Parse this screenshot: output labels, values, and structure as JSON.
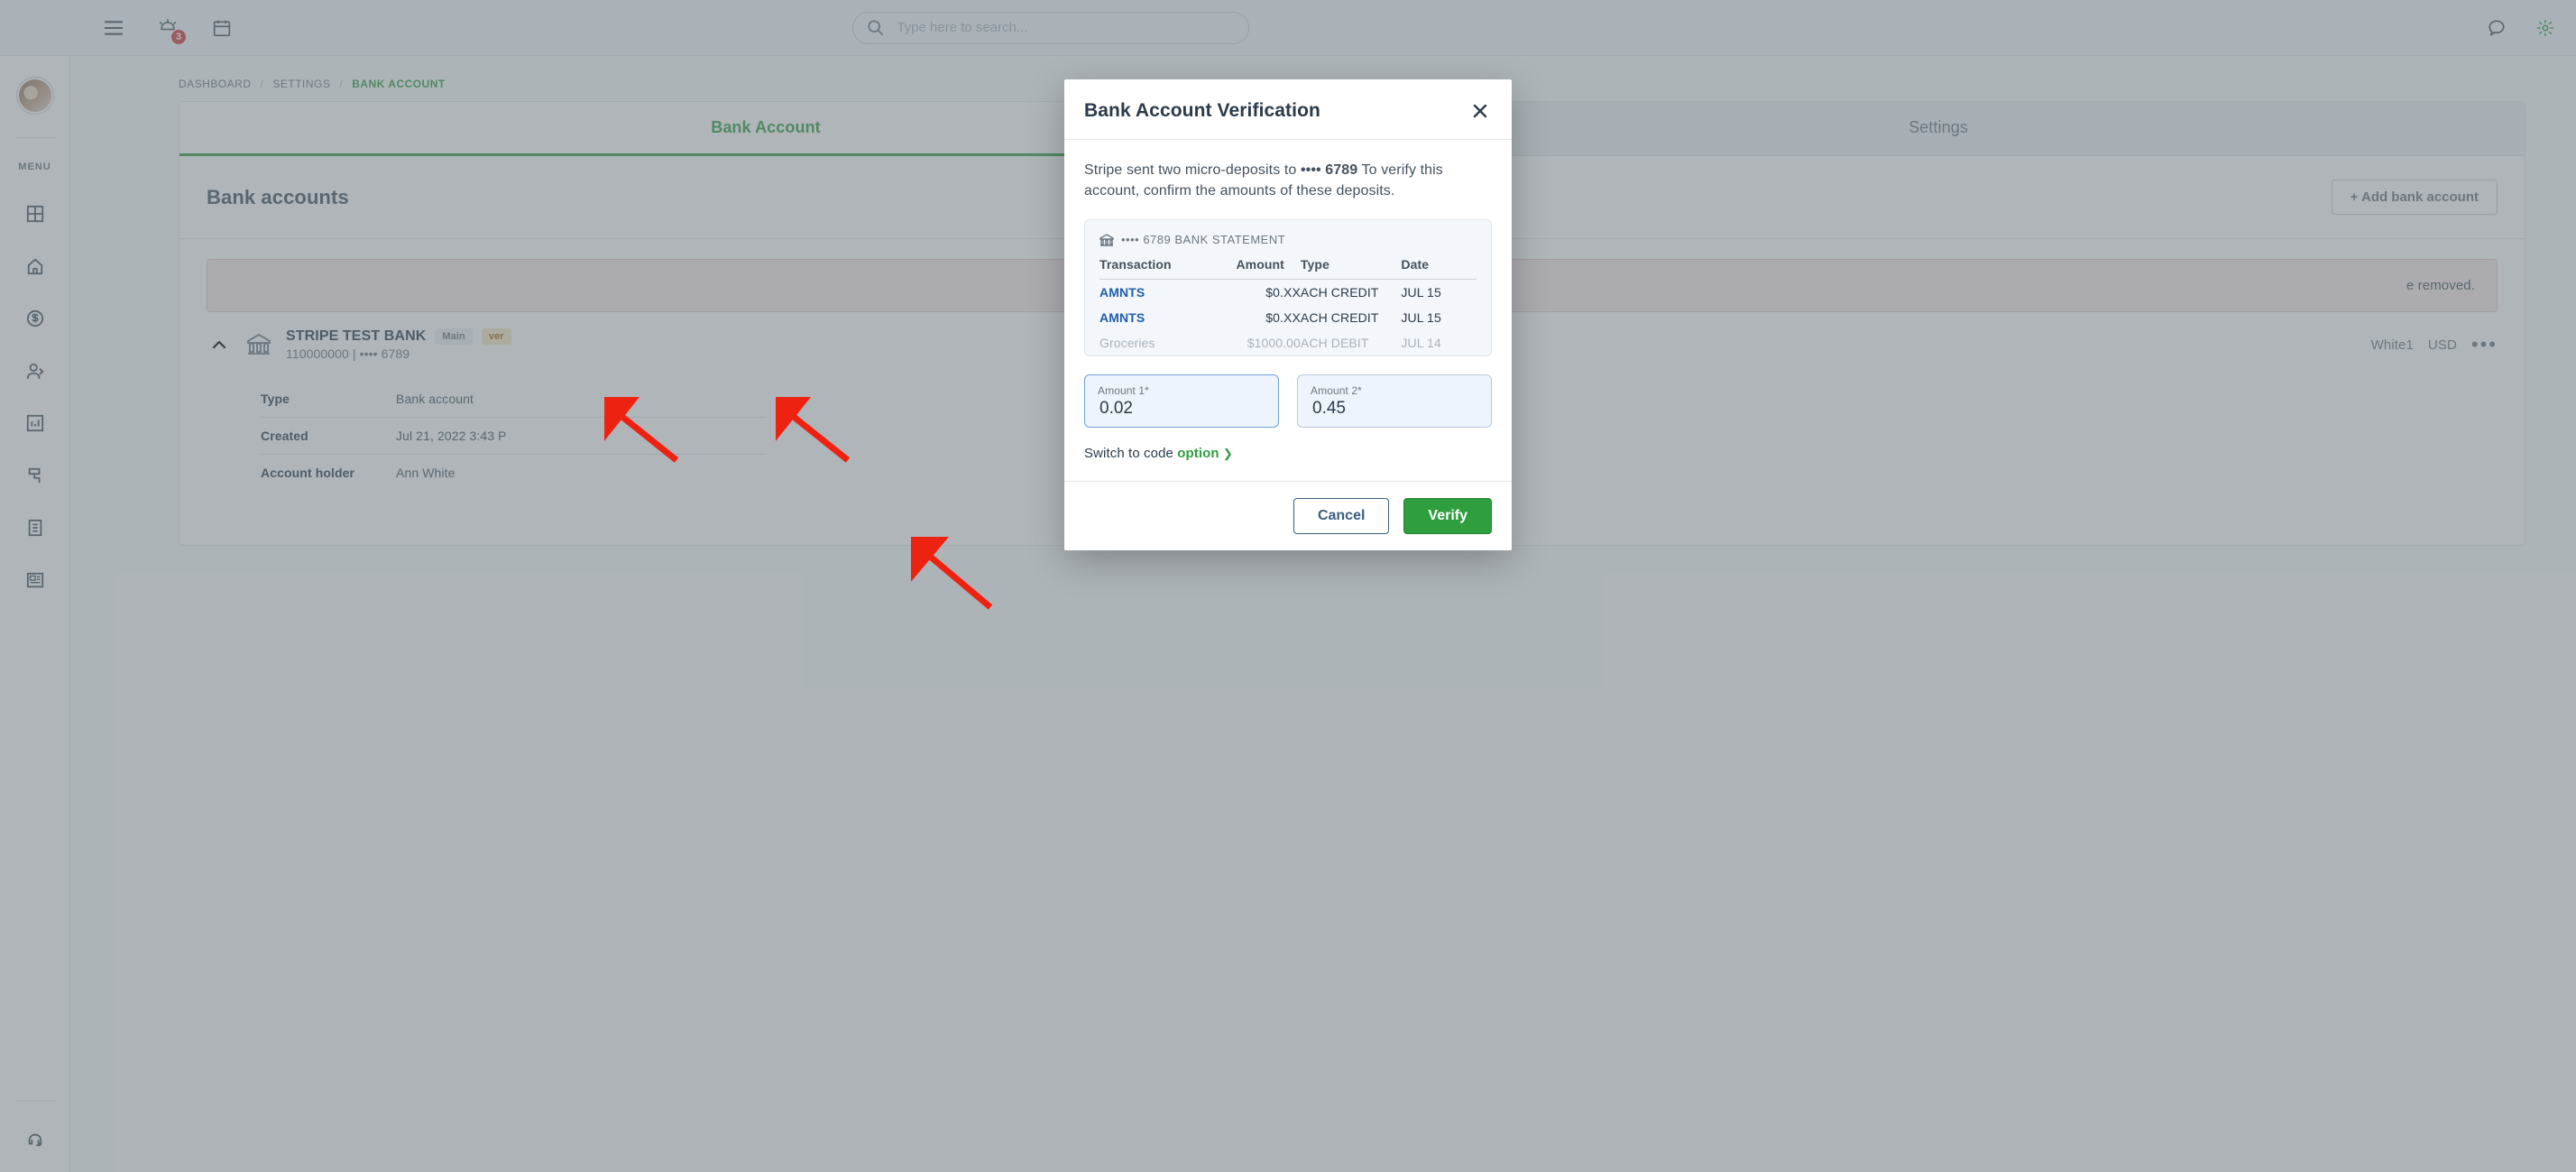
{
  "topbar": {
    "search_placeholder": "Type here to search...",
    "notification_count": "3"
  },
  "sidebar": {
    "menu_label": "MENU"
  },
  "breadcrumbs": {
    "0": "DASHBOARD",
    "1": "SETTINGS",
    "2": "BANK ACCOUNT"
  },
  "tabs": {
    "bank": "Bank Account",
    "settings": "Settings"
  },
  "section": {
    "title": "Bank accounts",
    "add_btn": "+ Add bank account"
  },
  "alert": {
    "text_tail": "e removed."
  },
  "account": {
    "name": "STRIPE TEST BANK",
    "main_pill": "Main",
    "ver_pill": "ver",
    "routing_mask": "110000000 | •••• 6789",
    "holder_name": "White1",
    "currency": "USD"
  },
  "kv": {
    "type_k": "Type",
    "type_v": "Bank account",
    "created_k": "Created",
    "created_v": "Jul 21, 2022 3:43 P",
    "holder_k": "Account holder",
    "holder_v": "Ann White"
  },
  "modal": {
    "title": "Bank Account Verification",
    "desc_prefix": "Stripe sent two micro-deposits to ",
    "desc_mask": "•••• 6789",
    "desc_suffix": " To verify this account, confirm the amounts of these deposits.",
    "stmt_title": "•••• 6789 BANK STATEMENT",
    "cols": {
      "txn": "Transaction",
      "amt": "Amount",
      "type": "Type",
      "date": "Date"
    },
    "rows": {
      "r1": {
        "txn": "AMNTS",
        "amt": "$0.XX",
        "type": "ACH CREDIT",
        "date": "JUL 15"
      },
      "r2": {
        "txn": "AMNTS",
        "amt": "$0.XX",
        "type": "ACH CREDIT",
        "date": "JUL 15"
      },
      "r3": {
        "txn": "Groceries",
        "amt": "$1000.00",
        "type": "ACH DEBIT",
        "date": "JUL 14"
      }
    },
    "amount1_label": "Amount 1*",
    "amount2_label": "Amount 2*",
    "amount1_val": "0.02",
    "amount2_val": "0.45",
    "switch_prefix": "Switch to code ",
    "switch_option": "option",
    "cancel": "Cancel",
    "verify": "Verify"
  }
}
